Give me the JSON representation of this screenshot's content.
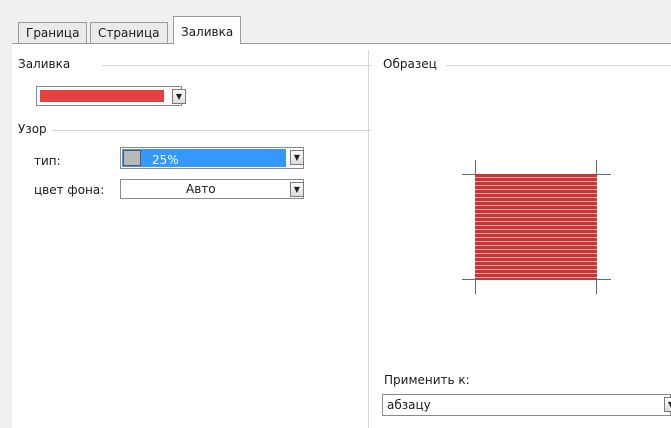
{
  "tabs": [
    {
      "label": "Граница",
      "active": false
    },
    {
      "label": "Страница",
      "active": false
    },
    {
      "label": "Заливка",
      "active": true
    }
  ],
  "fill": {
    "group_label": "Заливка",
    "color": "#e54141"
  },
  "pattern": {
    "group_label": "Узор",
    "type_label": "тип:",
    "type_value": "25%",
    "bgcolor_label": "цвет фона:",
    "bgcolor_value": "Авто"
  },
  "sample": {
    "group_label": "Образец",
    "fill_color": "#c93434"
  },
  "apply": {
    "label": "Применить к:",
    "value": "абзацу"
  },
  "icons": {
    "dropdown": "chevron-down-icon"
  }
}
